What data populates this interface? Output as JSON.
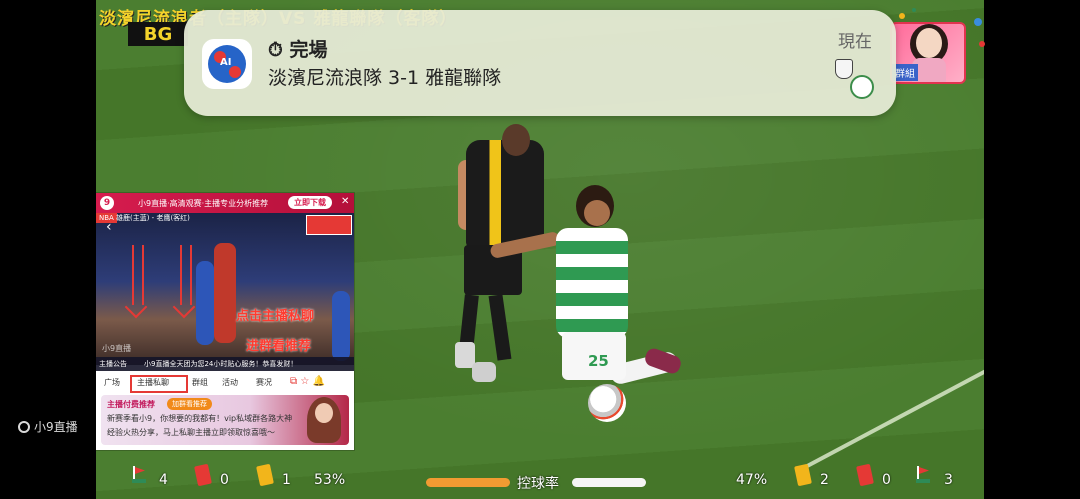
{
  "match_title": "淡濱尼流浪者（主隊）VS 雅龍聯隊（客隊）",
  "sponsor_logo": "BG",
  "notification": {
    "app_icon": "football-ai-app-icon",
    "status_icon": "stopwatch-icon",
    "title": "完場",
    "body": "淡濱尼流浪隊 3-1 雅龍聯隊",
    "time": "現在"
  },
  "top_right_ad": {
    "label": "群組"
  },
  "player_number": "25",
  "pip": {
    "top_banner": "小9直播·高清观赛·主播专业分析推荐",
    "download_button": "立即下载",
    "video_badge": "NBA",
    "video_teams": "雄鹿(主蓝) - 老鹰(客红)",
    "overlay_line1": "点击主播私聊",
    "overlay_line2": "进群看推荐",
    "video_watermark": "小9直播",
    "ticker_left": "主播公告",
    "ticker_text": "小9直播全天团为您24小时贴心服务！恭喜发财！",
    "tabs": [
      "广场",
      "主播私聊",
      "群组",
      "活动",
      "赛况"
    ],
    "ad": {
      "heading": "主播付费推荐",
      "tag": "加群看推荐",
      "line1": "新赛季看小9，你想要的我都有！vip私域群各路大神",
      "line2": "经验火热分享，马上私聊主播立即领取惊喜哦～"
    }
  },
  "app_watermark": "小9直播",
  "stats": {
    "home_corners": "4",
    "home_red": "0",
    "home_yellow": "1",
    "home_possession": "53%",
    "possession_label": "控球率",
    "away_possession": "47%",
    "away_yellow": "2",
    "away_red": "0",
    "away_corners": "3"
  },
  "colors": {
    "pitch": "#4b7e30",
    "possession_home": "#f29b32",
    "possession_away": "#f5f5f5",
    "pip_brand": "#d61c4e"
  }
}
